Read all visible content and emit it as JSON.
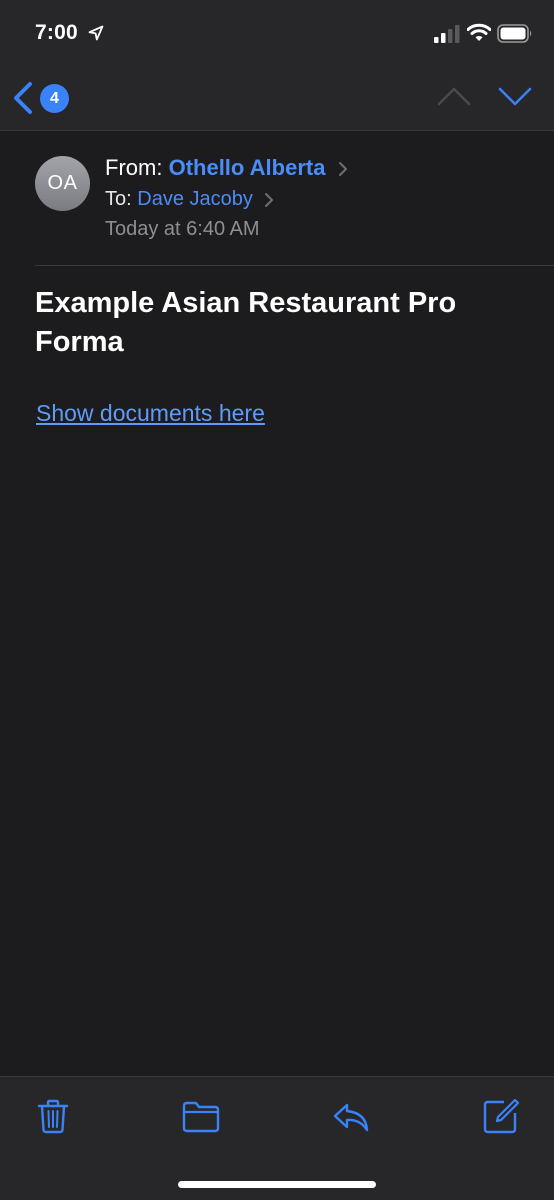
{
  "status_bar": {
    "time": "7:00",
    "location_icon": "location-arrow-icon",
    "signal_icon": "cellular-signal-icon",
    "wifi_icon": "wifi-icon",
    "battery_icon": "battery-icon"
  },
  "nav": {
    "back_icon": "chevron-left-icon",
    "unread_count": "4",
    "prev_icon": "chevron-up-icon",
    "next_icon": "chevron-down-icon"
  },
  "message": {
    "avatar_initials": "OA",
    "from_label": "From:",
    "from_name": "Othello Alberta",
    "to_label": "To:",
    "to_name": "Dave Jacoby",
    "date": "Today at 6:40 AM",
    "subject": "Example Asian Restaurant Pro Forma",
    "link_text": "Show documents here"
  },
  "toolbar": {
    "trash_icon": "trash-icon",
    "folder_icon": "folder-icon",
    "reply_icon": "reply-icon",
    "compose_icon": "compose-icon"
  },
  "colors": {
    "background": "#1c1c1e",
    "bar_background": "#27272a",
    "accent": "#3a82f7",
    "link": "#5e9cf8",
    "secondary_text": "#8e8e93"
  }
}
